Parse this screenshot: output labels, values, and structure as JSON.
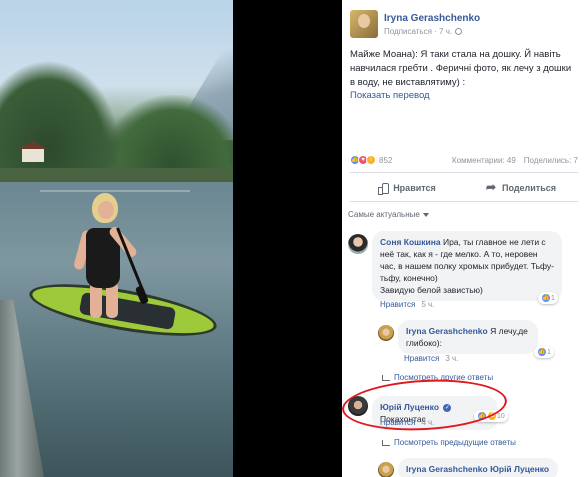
{
  "post": {
    "author": "Iryna Gerashchenko",
    "meta": "Подписаться · 7 ч.",
    "text": "Майже Моана): Я таки стала на дошку. Й навіть навчилася гребти . Феричні фото, як лечу з дошки в воду, не виставлятиму) :",
    "translate_label": "Показать перевод",
    "reaction_count": "852",
    "comments_count": "Комментарии: 49",
    "shares_count": "Поделились: 7",
    "like_label": "Нравится",
    "share_label": "Поделиться",
    "sort_label": "Самые актуальные"
  },
  "comments": [
    {
      "author": "Соня Кошкина",
      "text": "Ира, ты главное не лети с неё так, как я - где мелко. А то, неровен час, в нашем полку хромых прибудет. Тьфу-тьфу, конечно)",
      "text2": "Завидую белой завистью)",
      "like_label": "Нравится",
      "time": "5 ч.",
      "reactions": "1"
    },
    {
      "author": "Iryna Gerashchenko",
      "text": "Я лечу,де глибоко):",
      "like_label": "Нравится",
      "time": "3 ч.",
      "reactions": "1"
    },
    {
      "more": "Посмотреть другие ответы"
    },
    {
      "author": "Юрій Луценко",
      "text": "Покахонтас",
      "like_label": "Нравится",
      "time": "4 ч.",
      "reactions": "10"
    },
    {
      "more": "Посмотреть предыдущие ответы"
    },
    {
      "author": "Iryna Gerashchenko",
      "text": "Юрій Луценко"
    }
  ],
  "colors": {
    "link": "#365899",
    "like": "#5890ff",
    "love": "#f25268",
    "wow": "#f7b125",
    "highlight": "#e0191f"
  }
}
